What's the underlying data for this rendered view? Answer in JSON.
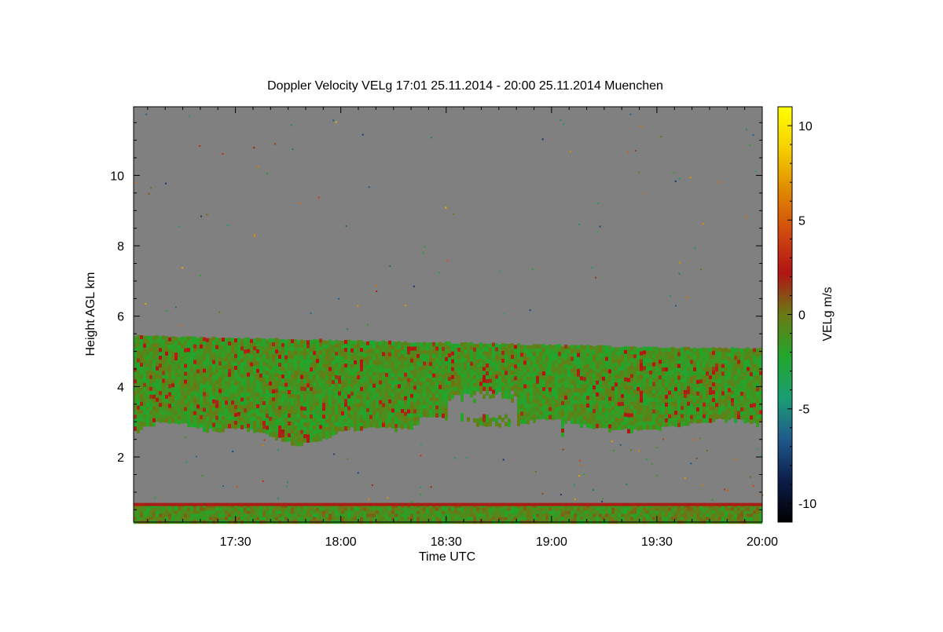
{
  "chart_data": {
    "type": "heatmap",
    "title": "Doppler Velocity VELg   17:01 25.11.2014 - 20:00 25.11.2014 Muenchen",
    "xlabel": "Time UTC",
    "ylabel": "Height AGL km",
    "colorbar_label": "VELg m/s",
    "xlim": [
      "17:01",
      "20:00"
    ],
    "x_ticks": [
      "17:30",
      "18:00",
      "18:30",
      "19:00",
      "19:30",
      "20:00"
    ],
    "ylim": [
      0.15,
      11.95
    ],
    "y_ticks": [
      2,
      4,
      6,
      8,
      10
    ],
    "colorbar_range": [
      -11,
      11
    ],
    "colorbar_ticks": [
      -10,
      -5,
      0,
      5,
      10
    ],
    "colorscale": [
      "#000000",
      "#0b1d4a",
      "#1f5a8c",
      "#1a9e73",
      "#22a62a",
      "#6a7a14",
      "#b01414",
      "#d24a0e",
      "#e08a00",
      "#f5d000",
      "#ffff00"
    ],
    "no_signal_color": "#808080",
    "features": {
      "cloud_layer": {
        "top_km": [
          5.45,
          5.1
        ],
        "base_km": [
          2.6,
          3.0
        ],
        "velocity_ms": [
          -3,
          1
        ]
      },
      "clear_gap": {
        "from": "18:30",
        "to": "18:50",
        "height_km": [
          3.0,
          3.9
        ]
      },
      "near_surface_layer": {
        "height_km": [
          0.2,
          0.65
        ],
        "velocity_ms": [
          -2,
          2
        ]
      },
      "red_band": {
        "height_km": 0.65,
        "velocity_ms": 2
      }
    }
  }
}
